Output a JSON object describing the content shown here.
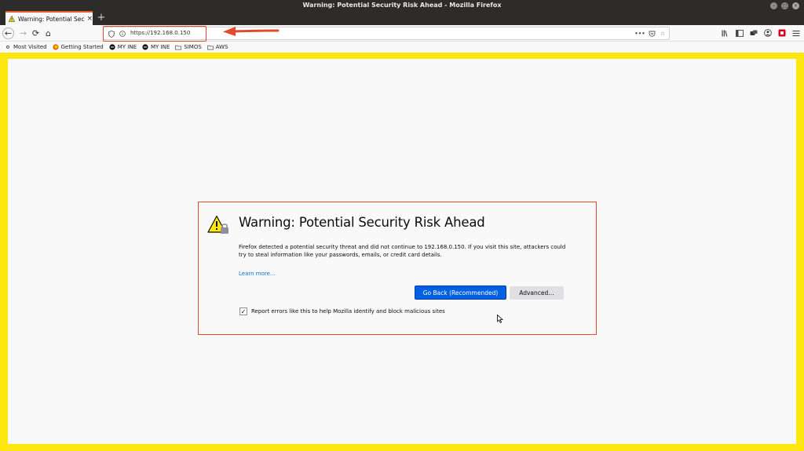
{
  "window": {
    "title": "Warning: Potential Security Risk Ahead - Mozilla Firefox"
  },
  "tab": {
    "title": "Warning: Potential Secu",
    "close": "×",
    "new_tab": "+"
  },
  "nav": {
    "back": "←",
    "forward": "→",
    "reload": "⟳",
    "home": "⌂",
    "url": "https://192.168.0.150"
  },
  "bookmarks": [
    {
      "label": "Most Visited",
      "icon": "gear-icon"
    },
    {
      "label": "Getting Started",
      "icon": "firefox-icon"
    },
    {
      "label": "MY INE",
      "icon": "ine-icon"
    },
    {
      "label": "MY INE",
      "icon": "ine-icon"
    },
    {
      "label": "SIMOS",
      "icon": "folder-icon"
    },
    {
      "label": "AWS",
      "icon": "folder-icon"
    }
  ],
  "warning": {
    "title": "Warning: Potential Security Risk Ahead",
    "description": "Firefox detected a potential security threat and did not continue to 192.168.0.150. If you visit this site, attackers could try to steal information like your passwords, emails, or credit card details.",
    "learn_more": "Learn more…",
    "go_back": "Go Back (Recommended)",
    "advanced": "Advanced…",
    "report_label": "Report errors like this to help Mozilla identify and block malicious sites",
    "report_checked": "✓"
  },
  "colors": {
    "accent_red": "#e3492c",
    "primary_blue": "#0060df",
    "frame_yellow": "#fce80f"
  }
}
